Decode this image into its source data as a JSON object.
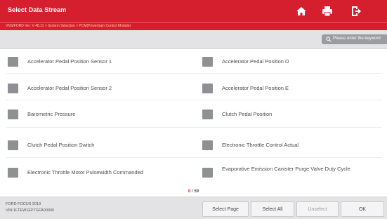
{
  "header": {
    "title": "Select Data Stream",
    "breadcrumb": "VNS/FORD Ver: V 48.11 > System Selection > PCM(Powertrain Control Module)"
  },
  "toolbar": {
    "search_label": "Please enter the keyword"
  },
  "items": [
    {
      "label": "Accelerator Pedal Position Sensor 1"
    },
    {
      "label": "Accelerator Pedal Position D"
    },
    {
      "label": "Accelerator Pedal Position Sensor 2"
    },
    {
      "label": "Accelerator Pedal Position E"
    },
    {
      "label": "Barometric Pressure"
    },
    {
      "label": "Clutch Pedal Position"
    },
    {
      "label": "Clutch Pedal Position Switch"
    },
    {
      "label": "Electronic Throttle Control Actual"
    },
    {
      "label": "Electronic Throttle Motor Pulsewidth Commanded"
    },
    {
      "label": "Evaporative Emission Canister Purge Valve Duty Cycle"
    }
  ],
  "pager": {
    "current": "0",
    "separator": "/",
    "total": "59"
  },
  "footer": {
    "vehicle_line1": "FORD FOCUS 2019",
    "vehicle_line2": "VIN:1FTEW1EP7GFA00000",
    "buttons": {
      "select_page": "Select Page",
      "select_all": "Select All",
      "unselect": "Unselect",
      "ok": "OK"
    }
  },
  "colors": {
    "accent_red": "#d51e2e",
    "checkbox_gray": "#8e9094",
    "toolbar_gray": "#e3e3e5"
  }
}
